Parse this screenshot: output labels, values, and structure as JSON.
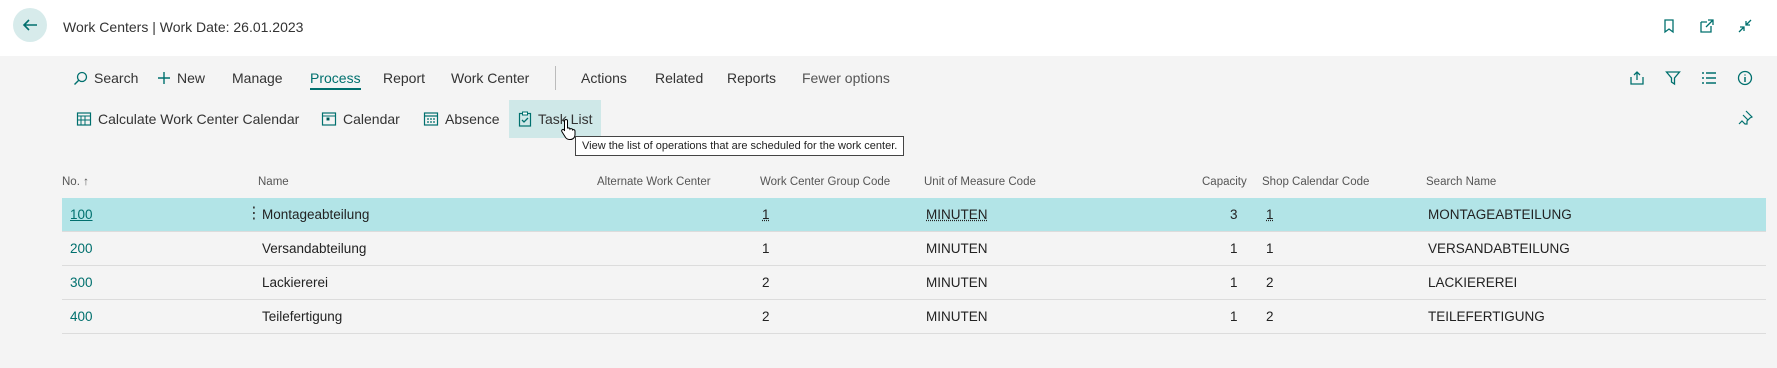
{
  "header": {
    "title": "Work Centers | Work Date: 26.01.2023"
  },
  "action_bar": {
    "search": "Search",
    "new": "New",
    "manage": "Manage",
    "process": "Process",
    "report": "Report",
    "work_center": "Work Center",
    "actions": "Actions",
    "related": "Related",
    "reports": "Reports",
    "fewer_options": "Fewer options"
  },
  "process_actions": {
    "calculate": "Calculate Work Center Calendar",
    "calendar": "Calendar",
    "absence": "Absence",
    "task_list": "Task List"
  },
  "tooltip": "View the list of operations that are scheduled for the work center.",
  "columns": {
    "no": "No. ↑",
    "name": "Name",
    "alternate": "Alternate Work Center",
    "group": "Work Center Group Code",
    "uom": "Unit of Measure Code",
    "capacity": "Capacity",
    "shop_calendar": "Shop Calendar Code",
    "search_name": "Search Name"
  },
  "rows": [
    {
      "no": "100",
      "name": "Montageabteilung",
      "group": "1",
      "uom": "MINUTEN",
      "capacity": "3",
      "shop": "1",
      "search": "MONTAGEABTEILUNG"
    },
    {
      "no": "200",
      "name": "Versandabteilung",
      "group": "1",
      "uom": "MINUTEN",
      "capacity": "1",
      "shop": "1",
      "search": "VERSANDABTEILUNG"
    },
    {
      "no": "300",
      "name": "Lackiererei",
      "group": "2",
      "uom": "MINUTEN",
      "capacity": "1",
      "shop": "2",
      "search": "LACKIEREREI"
    },
    {
      "no": "400",
      "name": "Teilefertigung",
      "group": "2",
      "uom": "MINUTEN",
      "capacity": "1",
      "shop": "2",
      "search": "TEILEFERTIGUNG"
    }
  ],
  "colors": {
    "accent": "#00706e",
    "selected_row": "#b2e4e7"
  }
}
